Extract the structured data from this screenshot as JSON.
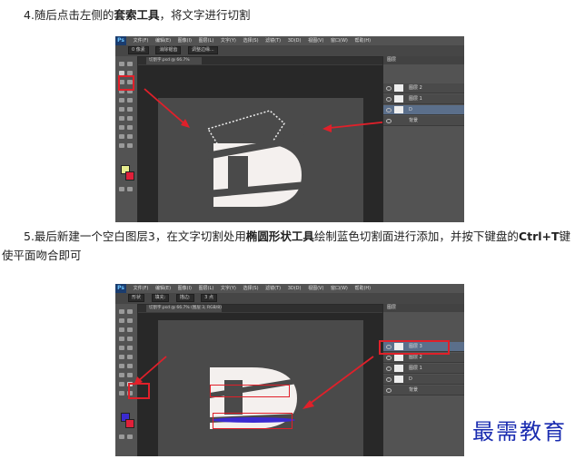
{
  "step4": {
    "prefix": "4.随后点击左侧的",
    "bold": "套索工具",
    "suffix": "，将文字进行切割"
  },
  "step5": {
    "part1": "5.最后新建一个空白图层3，在文字切割处用",
    "bold1": "椭圆形状工具",
    "part2": "绘制蓝色切割面进行添加，并按下键盘的",
    "bold2": "Ctrl+T",
    "part3": "键",
    "line2": "使平面吻合即可"
  },
  "screenshot1": {
    "app_logo": "Ps",
    "menu": [
      "文件(F)",
      "编辑(E)",
      "图像(I)",
      "图层(L)",
      "文字(Y)",
      "选择(S)",
      "滤镜(T)",
      "3D(D)",
      "视图(V)",
      "窗口(W)",
      "帮助(H)"
    ],
    "options": [
      "0 像素",
      "消除锯齿",
      "调整边缘..."
    ],
    "tab": "切割字.psd @ 66.7%",
    "panel_title": "图层",
    "layers": [
      "图层 2",
      "图层 1",
      "D",
      "背景"
    ],
    "letter": "D"
  },
  "screenshot2": {
    "app_logo": "Ps",
    "menu": [
      "文件(F)",
      "编辑(E)",
      "图像(I)",
      "图层(L)",
      "文字(Y)",
      "选择(S)",
      "滤镜(T)",
      "3D(D)",
      "视图(V)",
      "窗口(W)",
      "帮助(H)"
    ],
    "options": [
      "形状",
      "填充:",
      "描边:",
      "3 点"
    ],
    "tab": "切割字.psd @ 66.7% (图层 3, RGB/8)",
    "panel_title": "图层",
    "layers": [
      "图层 3",
      "图层 2",
      "图层 1",
      "D",
      "背景"
    ],
    "letter": "D"
  },
  "watermark": "最需教育",
  "colors": {
    "highlight_red": "#e0202a",
    "cut_blue": "#3b2bd0",
    "watermark_blue": "#1a2cb0",
    "letter": "#f4f0ee"
  }
}
